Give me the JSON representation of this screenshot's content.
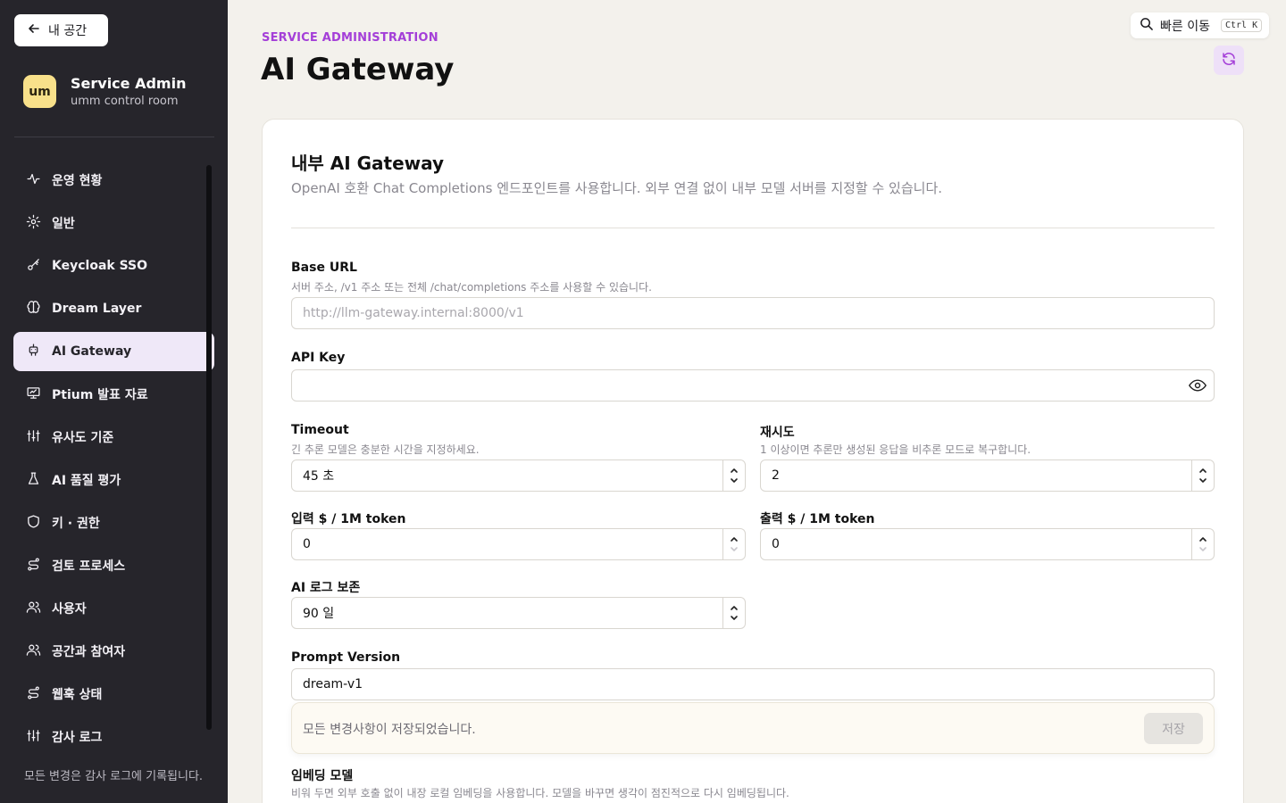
{
  "sidebar": {
    "back_label": "내 공간",
    "brand_logo": "um",
    "brand_title": "Service Admin",
    "brand_sub": "umm control room",
    "items": [
      {
        "label": "운영 현황",
        "icon": "activity-icon"
      },
      {
        "label": "일반",
        "icon": "gear-icon"
      },
      {
        "label": "Keycloak SSO",
        "icon": "key-icon"
      },
      {
        "label": "Dream Layer",
        "icon": "brain-icon"
      },
      {
        "label": "AI Gateway",
        "icon": "bot-icon",
        "active": true
      },
      {
        "label": "Ptium 발표 자료",
        "icon": "presentation-icon"
      },
      {
        "label": "유사도 기준",
        "icon": "sliders-icon"
      },
      {
        "label": "AI 품질 평가",
        "icon": "flask-icon"
      },
      {
        "label": "키 · 권한",
        "icon": "shield-icon"
      },
      {
        "label": "검토 프로세스",
        "icon": "route-icon"
      },
      {
        "label": "사용자",
        "icon": "users-icon"
      },
      {
        "label": "공간과 참여자",
        "icon": "users-icon"
      },
      {
        "label": "웹훅 상태",
        "icon": "route-icon"
      },
      {
        "label": "감사 로그",
        "icon": "sliders-icon"
      }
    ],
    "footer": "모든 변경은 감사 로그에 기록됩니다."
  },
  "header": {
    "eyebrow": "SERVICE ADMINISTRATION",
    "title": "AI Gateway",
    "quick_nav_label": "빠른 이동",
    "quick_nav_shortcut": "Ctrl K"
  },
  "section": {
    "title": "내부 AI Gateway",
    "description": "OpenAI 호환 Chat Completions 엔드포인트를 사용합니다. 외부 연결 없이 내부 모델 서버를 지정할 수 있습니다."
  },
  "fields": {
    "base_url": {
      "label": "Base URL",
      "hint": "서버 주소, /v1 주소 또는 전체 /chat/completions 주소를 사용할 수 있습니다.",
      "placeholder": "http://llm-gateway.internal:8000/v1",
      "value": ""
    },
    "api_key": {
      "label": "API Key",
      "value": ""
    },
    "timeout": {
      "label": "Timeout",
      "hint": "긴 추론 모델은 충분한 시간을 지정하세요.",
      "value": "45 초"
    },
    "retry": {
      "label": "재시도",
      "hint": "1 이상이면 추론만 생성된 응답을 비추론 모드로 복구합니다.",
      "value": "2"
    },
    "input_price": {
      "label": "입력 $ / 1M token",
      "value": "0"
    },
    "output_price": {
      "label": "출력 $ / 1M token",
      "value": "0"
    },
    "log_retention": {
      "label": "AI 로그 보존",
      "value": "90 일"
    },
    "prompt_version": {
      "label": "Prompt Version",
      "value": "dream-v1"
    },
    "embedding_model": {
      "label": "임베딩 모델",
      "hint": "비워 두면 외부 호출 없이 내장 로컬 임베딩을 사용합니다. 모델을 바꾸면 생각이 점진적으로 다시 임베딩됩니다."
    }
  },
  "save_bar": {
    "status": "모든 변경사항이 저장되었습니다.",
    "save_label": "저장"
  },
  "colors": {
    "accent": "#a43fd8",
    "sidebar_bg": "#26252b",
    "active_item_bg": "#efe8f8",
    "brand_logo_bg": "#f8e08a"
  }
}
